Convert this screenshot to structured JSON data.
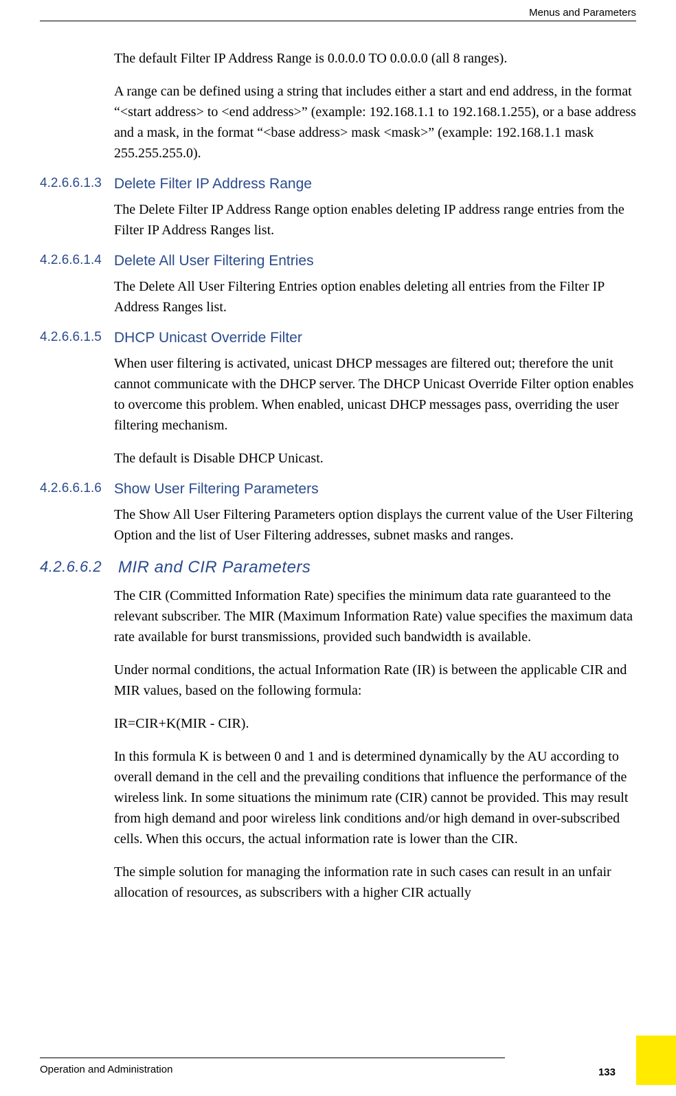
{
  "header": {
    "right": "Menus and Parameters"
  },
  "paragraphs": {
    "p1": "The default Filter IP Address Range is 0.0.0.0 TO 0.0.0.0 (all 8 ranges).",
    "p2": "A range can be defined using a string that includes either a start and end address, in the format “<start address> to <end address>” (example: 192.168.1.1 to 192.168.1.255), or a base address and a mask, in the format “<base address> mask <mask>” (example: 192.168.1.1 mask 255.255.255.0).",
    "s3_p1": "The Delete Filter IP Address Range option enables deleting IP address range entries from the Filter IP Address Ranges list.",
    "s4_p1": "The Delete All User Filtering Entries option enables deleting all entries from the Filter IP Address Ranges list.",
    "s5_p1": "When user filtering is activated, unicast DHCP messages are filtered out; therefore the unit cannot communicate with the DHCP server. The DHCP Unicast Override Filter option enables to overcome this problem. When enabled, unicast DHCP messages pass, overriding the user filtering mechanism.",
    "s5_p2": "The default is Disable DHCP Unicast.",
    "s6_p1": "The Show All User Filtering Parameters option displays the current value of the User Filtering Option and the list of User Filtering addresses, subnet masks and ranges.",
    "h3_p1": "The CIR (Committed Information Rate) specifies the minimum data rate guaranteed to the relevant subscriber. The MIR (Maximum Information Rate) value specifies the maximum data rate available for burst transmissions, provided such bandwidth is available.",
    "h3_p2": "Under normal conditions, the actual Information Rate (IR) is between the applicable CIR and MIR values, based on the following formula:",
    "h3_p3": "IR=CIR+K(MIR - CIR).",
    "h3_p4": "In this formula K is between 0 and 1 and is determined dynamically by the AU according to overall demand in the cell and the prevailing conditions that influence the performance of the wireless link. In some situations the minimum rate (CIR) cannot be provided. This may result from high demand and poor wireless link conditions and/or high demand in over-subscribed cells. When this occurs, the actual information rate is lower than the CIR.",
    "h3_p5": "The simple solution for managing the information rate in such cases can result in an unfair allocation of resources, as subscribers with a higher CIR actually"
  },
  "sections": {
    "s3": {
      "num": "4.2.6.6.1.3",
      "title": "Delete Filter IP Address Range"
    },
    "s4": {
      "num": "4.2.6.6.1.4",
      "title": "Delete All User Filtering Entries"
    },
    "s5": {
      "num": "4.2.6.6.1.5",
      "title": "DHCP Unicast Override Filter"
    },
    "s6": {
      "num": "4.2.6.6.1.6",
      "title": "Show User Filtering Parameters"
    },
    "h3": {
      "num": "4.2.6.6.2",
      "title": "MIR and CIR Parameters"
    }
  },
  "footer": {
    "left": "Operation and Administration",
    "pagenum": "133"
  }
}
